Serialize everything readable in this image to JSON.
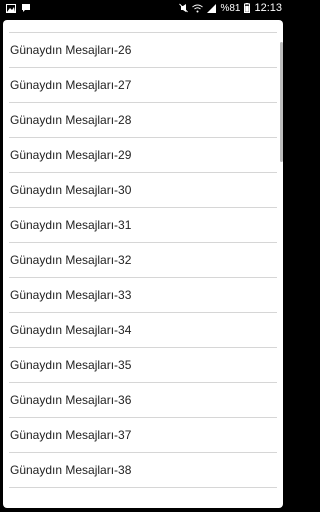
{
  "status_bar": {
    "left_icons": [
      "gallery-icon",
      "chat-icon"
    ],
    "right_icons": [
      "mute-icon",
      "wifi-icon",
      "signal-icon"
    ],
    "battery_percent": "%81",
    "time": "12:13"
  },
  "list": {
    "items": [
      {
        "label": "Günaydın Mesajları-26"
      },
      {
        "label": "Günaydın Mesajları-27"
      },
      {
        "label": "Günaydın Mesajları-28"
      },
      {
        "label": "Günaydın Mesajları-29"
      },
      {
        "label": "Günaydın Mesajları-30"
      },
      {
        "label": "Günaydın Mesajları-31"
      },
      {
        "label": "Günaydın Mesajları-32"
      },
      {
        "label": "Günaydın Mesajları-33"
      },
      {
        "label": "Günaydın Mesajları-34"
      },
      {
        "label": "Günaydın Mesajları-35"
      },
      {
        "label": "Günaydın Mesajları-36"
      },
      {
        "label": "Günaydın Mesajları-37"
      },
      {
        "label": "Günaydın Mesajları-38"
      }
    ]
  }
}
